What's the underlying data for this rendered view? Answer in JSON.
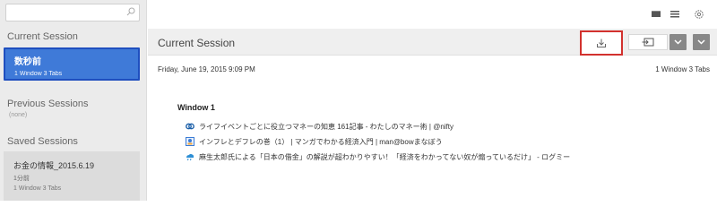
{
  "sidebar": {
    "search_placeholder": "",
    "current_title": "Current Session",
    "current_item": {
      "name": "数秒前",
      "meta": "1 Window   3 Tabs"
    },
    "previous_title": "Previous Sessions",
    "previous_empty": "(none)",
    "saved_title": "Saved Sessions",
    "saved_item": {
      "name": "お金の情報_2015.6.19",
      "time": "1分前",
      "meta": "1 Window   3 Tabs"
    }
  },
  "toolbar": {
    "icons": [
      "view-list-solid-icon",
      "view-list-lines-icon",
      "settings-gear-icon"
    ]
  },
  "header": {
    "title": "Current Session",
    "buttons": [
      "export-icon",
      "open-window-icon",
      "chevron-down-icon",
      "chevron-down-icon"
    ]
  },
  "info": {
    "date": "Friday, June 19, 2015 9:09 PM",
    "counts": "1 Window   3 Tabs"
  },
  "window": {
    "title": "Window 1",
    "tabs": [
      {
        "title": "ライフイベントごとに役立つマネーの知恵 161記事 - わたしのマネー術 | @nifty",
        "icon": "nifty-favicon",
        "color": "#1b5fa8"
      },
      {
        "title": "インフレとデフレの巻（1） | マンガでわかる経済入門 | man@bowまなぼう",
        "icon": "manabow-favicon",
        "color": "#3a7bd5"
      },
      {
        "title": "麻生太郎氏による「日本の借金」の解説が超わかりやすい！「経済をわかってない奴が煽っているだけ」 - ログミー",
        "icon": "logmi-favicon",
        "color": "#2d8fd5"
      }
    ]
  },
  "colors": {
    "accent": "#3f7ad8",
    "highlight": "#d2312e"
  }
}
